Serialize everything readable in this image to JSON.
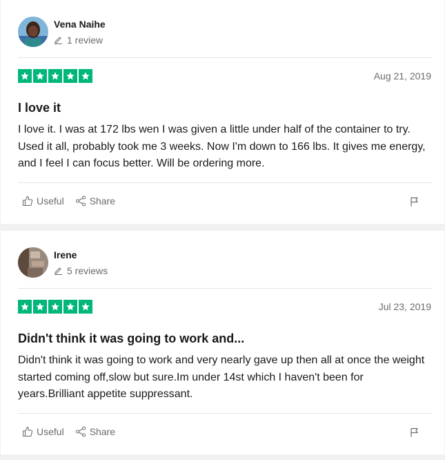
{
  "reviews": [
    {
      "reviewer_name": "Vena Naihe",
      "review_count": "1 review",
      "rating": 5,
      "date": "Aug 21, 2019",
      "title": "I love it",
      "body": "I love it. I was at 172 lbs wen I was given a little under half of the container to try. Used it all, probably took me 3 weeks. Now I'm down to 166 lbs. It gives me energy, and I feel I can focus better. Will be ordering more.",
      "useful_label": "Useful",
      "share_label": "Share"
    },
    {
      "reviewer_name": "Irene",
      "review_count": "5 reviews",
      "rating": 5,
      "date": "Jul 23, 2019",
      "title": "Didn't think it was going to work and...",
      "body": "Didn't think it was going to work and very nearly gave up then all at once the weight started coming off,slow but sure.Im under 14st which I haven't been for years.Brilliant appetite suppressant.",
      "useful_label": "Useful",
      "share_label": "Share"
    }
  ],
  "colors": {
    "star_green": "#00b67a",
    "muted_text": "#6b6b6b",
    "divider": "#e5e5dd"
  },
  "icons": [
    "avatar",
    "pencil-icon",
    "star-icon",
    "thumbs-up-icon",
    "share-icon",
    "flag-icon"
  ]
}
